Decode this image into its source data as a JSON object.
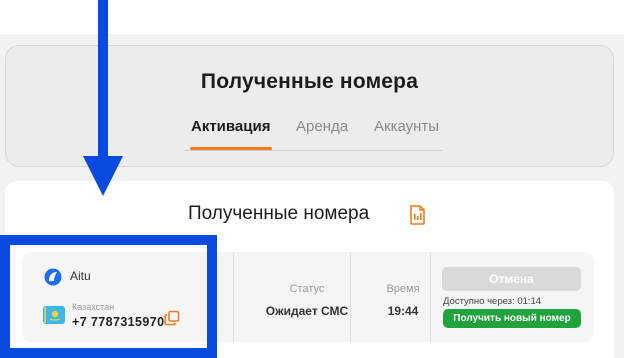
{
  "header": {
    "title": "Полученные номера",
    "tabs": [
      {
        "label": "Активация",
        "active": true
      },
      {
        "label": "Аренда",
        "active": false
      },
      {
        "label": "Аккаунты",
        "active": false
      }
    ]
  },
  "panel": {
    "title": "Полученные номера",
    "title_icon": "document-list-icon"
  },
  "row": {
    "service": "Aitu",
    "country": "Казахстан",
    "phone": "+7 7787315970",
    "status_label": "Статус",
    "status_value": "Ожидает СМС",
    "time_label": "Время",
    "time_value": "19:44",
    "cancel_label": "Отмена",
    "available_text": "Доступно через: 01:14",
    "new_number_label": "Получить новый номер"
  },
  "colors": {
    "accent": "#f07c1c",
    "annotation": "#0a4ae0",
    "success": "#1fa33a",
    "disabled": "#d9d9d9"
  }
}
